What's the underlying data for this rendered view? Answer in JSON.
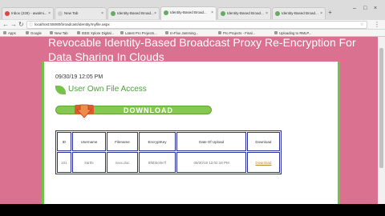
{
  "browser": {
    "tabs": [
      {
        "label": "Inbox (228) - awalmi..."
      },
      {
        "label": "New Tab"
      },
      {
        "label": "Identity-Based Broad..."
      },
      {
        "label": "Identity-Based Broad..."
      },
      {
        "label": "Identity-Based Broad..."
      },
      {
        "label": "Identity-Based Broad..."
      }
    ],
    "address": "localhost:55080/broadcast/identity/myfile.aspx",
    "bookmarks": [
      {
        "label": "Apps"
      },
      {
        "label": "Google"
      },
      {
        "label": "New Tab"
      },
      {
        "label": "IEEE Xplore Digital..."
      },
      {
        "label": "Latest Pro Projects..."
      },
      {
        "label": "In-Flux Jamming..."
      },
      {
        "label": "Pro Projects - Final..."
      },
      {
        "label": "Uploading to RMLP..."
      }
    ]
  },
  "page": {
    "site_title": "Revocable Identity-Based Broadcast Proxy Re-Encryption For Data Sharing In Clouds",
    "timestamp": "09/30/19 12:05 PM",
    "heading": "User Own File Access",
    "download_label": "DOWNLOAD",
    "table": {
      "headers": [
        "ID",
        "Username",
        "Filename",
        "EncryptKey",
        "Date Of Upload",
        "Download"
      ],
      "rows": [
        [
          "101",
          "karthi",
          "irxxx.doc",
          "8f6bbc8e7f",
          "09/30/19 12:02:18 PM",
          "Download"
        ]
      ]
    }
  },
  "colors": {
    "page_bg": "#da7190",
    "accent_green": "#6fc24a",
    "table_border": "#2a2f9a"
  }
}
